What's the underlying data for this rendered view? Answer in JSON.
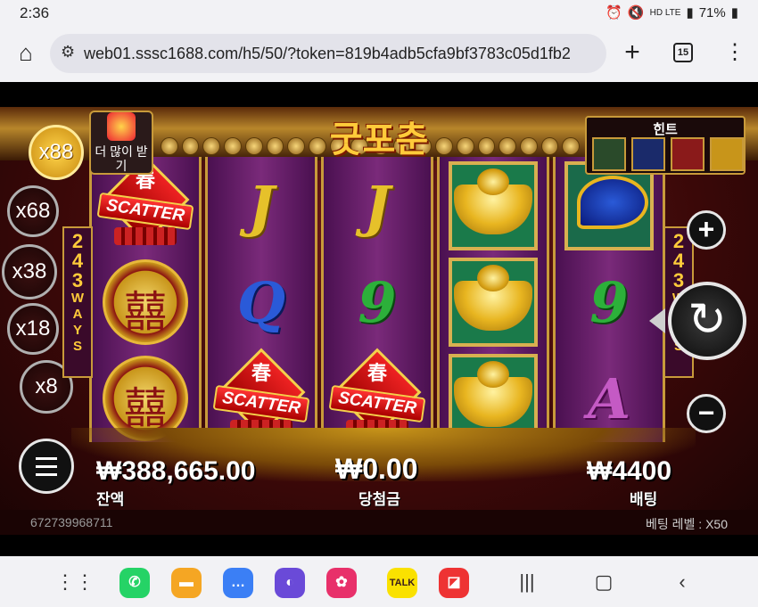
{
  "status": {
    "time": "2:36",
    "indicators": "HD LTE",
    "battery": "71%"
  },
  "browser": {
    "url": "web01.sssc1688.com/h5/50/?token=819b4adb5cfa9bf3783c05d1fb2",
    "tab_count": "15",
    "home_icon": "home-icon",
    "add_icon": "plus-icon",
    "menu_icon": "kebab-menu-icon"
  },
  "game": {
    "title": "굿포춘",
    "get_more": "더 많이 받기",
    "ways_label": "243 WAYS",
    "hint_title": "힌트",
    "multipliers": [
      "x88",
      "x68",
      "x38",
      "x18",
      "x8"
    ],
    "active_multiplier": "x88",
    "reels": [
      [
        "scatter",
        "medallion",
        "medallion"
      ],
      [
        "J",
        "Q",
        "scatter"
      ],
      [
        "J",
        "9",
        "scatter"
      ],
      [
        "ingot",
        "ingot",
        "ingot"
      ],
      [
        "koi",
        "9",
        "A"
      ]
    ],
    "scatter_label": "SCATTER",
    "scatter_char": "春",
    "balance_value": "₩388,665.00",
    "balance_label": "잔액",
    "win_value": "₩0.00",
    "win_label": "당첨금",
    "bet_value": "₩4400",
    "bet_label": "배팅",
    "round_id": "672739968711",
    "bet_level": "베팅 레벨 : X50"
  },
  "colors": {
    "accent_gold": "#ffcb3a",
    "reel_purple": "#7a2a7a",
    "scatter_red": "#e22"
  }
}
